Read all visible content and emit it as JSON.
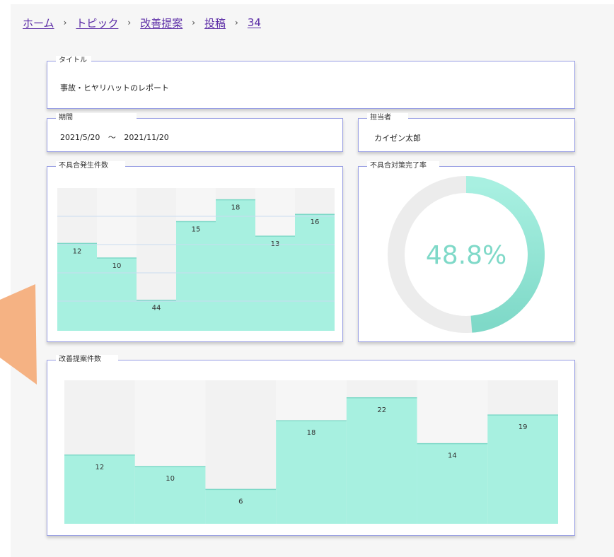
{
  "breadcrumb": {
    "items": [
      {
        "label": "ホーム",
        "name": "breadcrumb-home"
      },
      {
        "label": "トピック",
        "name": "breadcrumb-topic"
      },
      {
        "label": "改善提案",
        "name": "breadcrumb-kaizen"
      },
      {
        "label": "投稿",
        "name": "breadcrumb-post"
      },
      {
        "label": "34",
        "name": "breadcrumb-id"
      }
    ],
    "separator": "›"
  },
  "title_card": {
    "label": "タイトル",
    "value": "事故・ヒヤリハットのレポート"
  },
  "period_card": {
    "label": "期間",
    "start": "2021/5/20",
    "tilde": "〜",
    "end": "2021/11/20"
  },
  "owner_card": {
    "label": "担当者",
    "value": "カイゼン太郎"
  },
  "defect_chart": {
    "label": "不具合発生件数"
  },
  "completion_chart": {
    "label": "不具合対策完了率",
    "display": "48.8%"
  },
  "kaizen_chart": {
    "label": "改善提案件数"
  },
  "colors": {
    "link": "#5b2ca6",
    "card_border": "#9aa0e4",
    "bar_fill": "#a7f0e0",
    "donut_fill": "#7fd9c8",
    "donut_track": "#ececec",
    "arrow": "#f5b283"
  },
  "chart_data": [
    {
      "type": "bar",
      "title": "不具合発生件数",
      "categories": [
        "",
        "",
        "",
        "",
        "",
        "",
        ""
      ],
      "values": [
        12,
        10,
        44,
        15,
        18,
        13,
        16
      ],
      "ylim": [
        0,
        20
      ],
      "grid": true
    },
    {
      "type": "pie",
      "title": "不具合対策完了率",
      "values": [
        48.8,
        51.2
      ],
      "display": "48.8%"
    },
    {
      "type": "bar",
      "title": "改善提案件数",
      "categories": [
        "",
        "",
        "",
        "",
        "",
        "",
        ""
      ],
      "values": [
        12,
        10,
        6,
        18,
        22,
        14,
        19
      ],
      "ylim": [
        0,
        30
      ],
      "grid": false
    }
  ]
}
